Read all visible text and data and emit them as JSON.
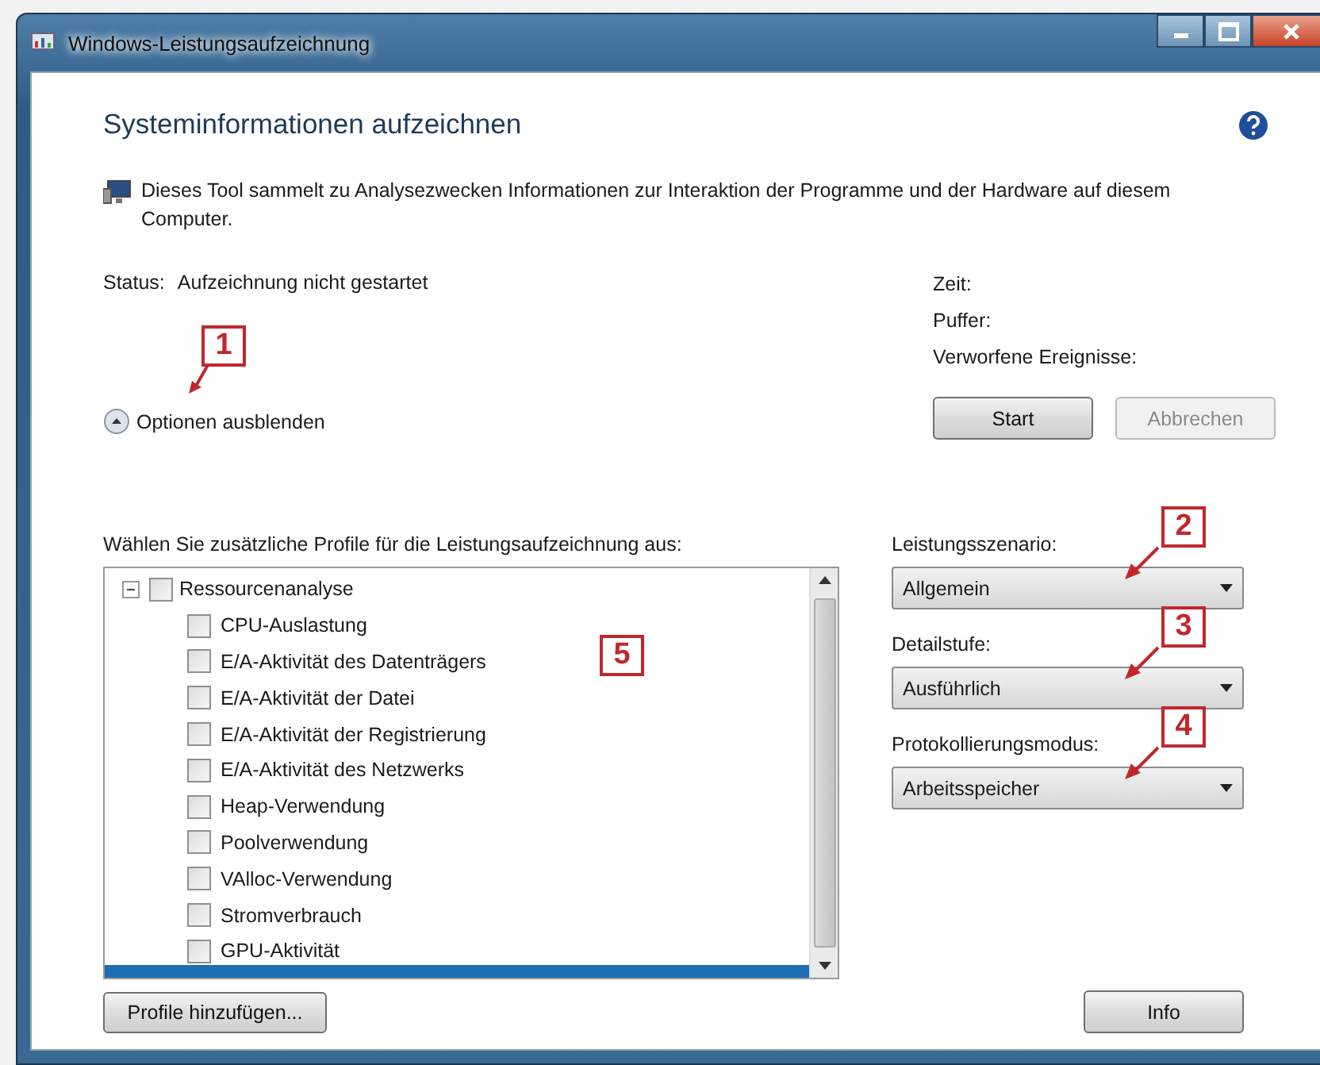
{
  "window": {
    "title": "Windows-Leistungsaufzeichnung"
  },
  "heading": "Systeminformationen aufzeichnen",
  "description": "Dieses Tool sammelt zu Analysezwecken Informationen zur Interaktion der Programme und der Hardware auf diesem Computer.",
  "status": {
    "label": "Status:",
    "value": "Aufzeichnung nicht gestartet"
  },
  "stats": [
    "Zeit:",
    "Puffer:",
    "Verworfene Ereignisse:"
  ],
  "buttons": [
    {
      "label": "Start",
      "disabled": false
    },
    {
      "label": "Abbrechen",
      "disabled": true
    }
  ],
  "options_toggle": {
    "label": "Optionen ausblenden",
    "callout": "1"
  },
  "profiles": {
    "label": "Wählen Sie zusätzliche Profile für die Leistungsaufzeichnung aus:",
    "callout": "5",
    "tree": [
      {
        "label": "Ressourcenanalyse",
        "checked": false,
        "expanded": true,
        "children": [
          {
            "label": "CPU-Auslastung",
            "checked": false
          },
          {
            "label": "E/A-Aktivität des Datenträgers",
            "checked": false
          },
          {
            "label": "E/A-Aktivität der Datei",
            "checked": false
          },
          {
            "label": "E/A-Aktivität der Registrierung",
            "checked": false
          },
          {
            "label": "E/A-Aktivität des Netzwerks",
            "checked": false
          },
          {
            "label": "Heap-Verwendung",
            "checked": false
          },
          {
            "label": "Poolverwendung",
            "checked": false
          },
          {
            "label": "VAlloc-Verwendung",
            "checked": false
          },
          {
            "label": "Stromverbrauch",
            "checked": false
          },
          {
            "label": "GPU-Aktivität",
            "checked": false
          }
        ]
      }
    ],
    "partial_row": {
      "selected": true
    },
    "add_button": "Profile hinzufügen..."
  },
  "dropdowns": [
    {
      "label": "Leistungsszenario:",
      "value": "Allgemein",
      "callout": "2"
    },
    {
      "label": "Detailstufe:",
      "value": "Ausführlich",
      "callout": "3"
    },
    {
      "label": "Protokollierungsmodus:",
      "value": "Arbeitsspeicher",
      "callout": "4"
    }
  ],
  "info_button": "Info"
}
